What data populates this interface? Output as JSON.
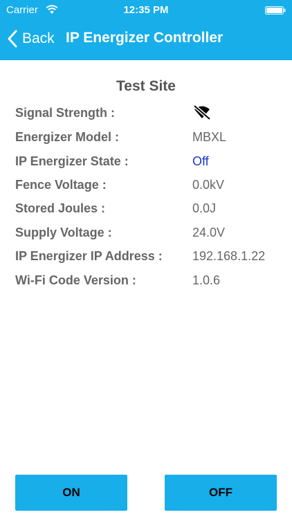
{
  "status_bar": {
    "carrier": "Carrier",
    "time": "12:35 PM",
    "wifi_icon": "wifi-icon",
    "battery_icon": "battery-icon"
  },
  "nav": {
    "back_label": "Back",
    "title": "IP Energizer Controller"
  },
  "site": {
    "name": "Test Site"
  },
  "details": [
    {
      "label": "Signal Strength :",
      "value": "",
      "icon": "no-signal-icon"
    },
    {
      "label": "Energizer Model :",
      "value": "MBXL"
    },
    {
      "label": "IP Energizer State :",
      "value": "Off",
      "value_color": "#1a35c9"
    },
    {
      "label": "Fence Voltage :",
      "value": "0.0kV"
    },
    {
      "label": "Stored Joules :",
      "value": "0.0J"
    },
    {
      "label": "Supply Voltage :",
      "value": "24.0V"
    },
    {
      "label": "IP Energizer IP Address :",
      "value": "192.168.1.22"
    },
    {
      "label": "Wi-Fi Code Version :",
      "value": "1.0.6"
    }
  ],
  "buttons": {
    "on_label": "ON",
    "off_label": "OFF"
  },
  "colors": {
    "accent": "#17aeea",
    "text": "#666666",
    "state_off": "#1a35c9"
  }
}
